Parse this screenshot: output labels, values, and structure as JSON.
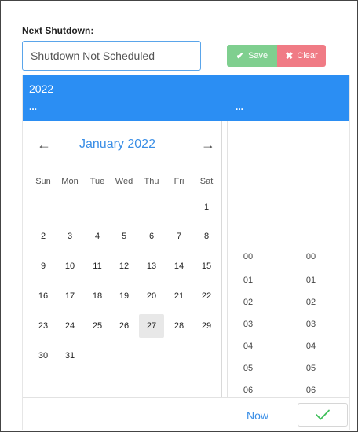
{
  "form": {
    "label": "Next Shutdown:",
    "input_value": "Shutdown Not Scheduled",
    "save_icon": "✔",
    "save_label": "Save",
    "clear_icon": "✖",
    "clear_label": "Clear"
  },
  "picker": {
    "year": "2022",
    "date_placeholder": "...",
    "time_placeholder": "...",
    "prev_arrow": "←",
    "next_arrow": "→",
    "month_year": "January 2022",
    "weekdays": [
      "Sun",
      "Mon",
      "Tue",
      "Wed",
      "Thu",
      "Fri",
      "Sat"
    ],
    "weeks": [
      [
        "",
        "",
        "",
        "",
        "",
        "",
        "1"
      ],
      [
        "2",
        "3",
        "4",
        "5",
        "6",
        "7",
        "8"
      ],
      [
        "9",
        "10",
        "11",
        "12",
        "13",
        "14",
        "15"
      ],
      [
        "16",
        "17",
        "18",
        "19",
        "20",
        "21",
        "22"
      ],
      [
        "23",
        "24",
        "25",
        "26",
        "27",
        "28",
        "29"
      ],
      [
        "30",
        "31",
        "",
        "",
        "",
        "",
        ""
      ]
    ],
    "selected_day": "27",
    "hours": [
      "00",
      "01",
      "02",
      "03",
      "04",
      "05",
      "06"
    ],
    "minutes": [
      "00",
      "01",
      "02",
      "03",
      "04",
      "05",
      "06"
    ],
    "now_label": "Now",
    "accent_color": "#2b8ef3",
    "confirm_color": "#3fbf5a"
  }
}
